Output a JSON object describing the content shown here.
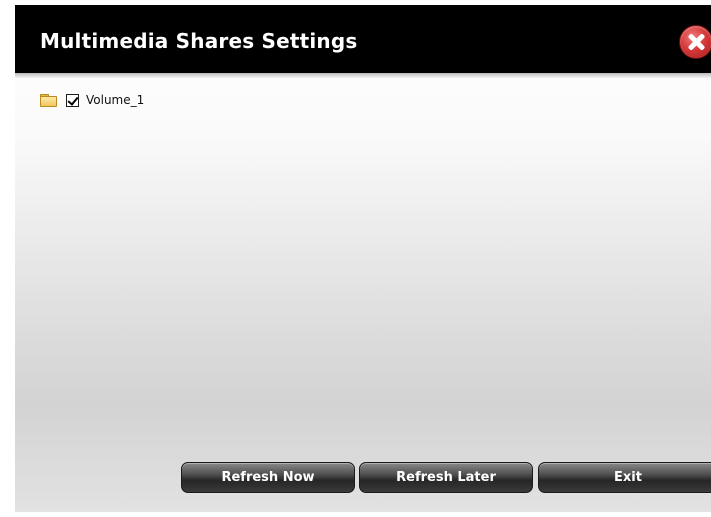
{
  "dialog": {
    "title": "Multimedia Shares Settings",
    "close_icon": "close-icon"
  },
  "tree": {
    "items": [
      {
        "label": "Volume_1",
        "checked": true,
        "icon": "folder-icon"
      }
    ]
  },
  "buttons": {
    "refresh_now": "Refresh Now",
    "refresh_later": "Refresh Later",
    "exit": "Exit"
  },
  "colors": {
    "titlebar": "#000000",
    "close_button": "#d63a3a",
    "button_dark": "#262626"
  }
}
